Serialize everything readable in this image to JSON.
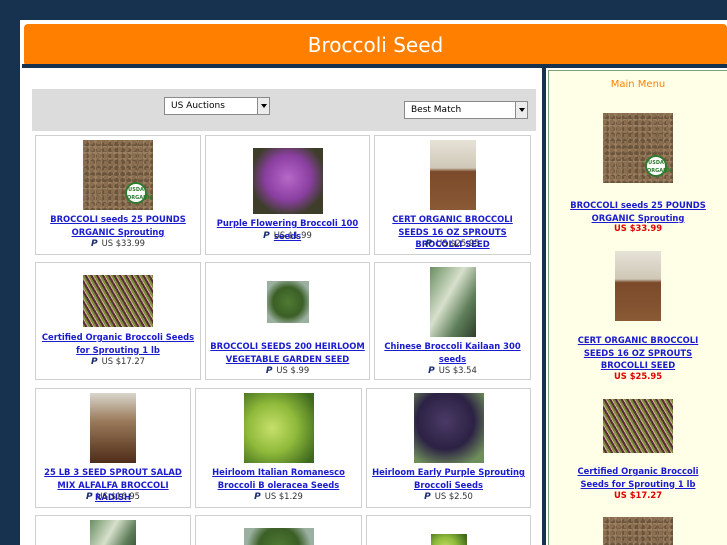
{
  "page": {
    "title": "Broccoli Seed"
  },
  "controls": {
    "auction_filter": "US Auctions",
    "sort_order": "Best Match"
  },
  "listings": [
    {
      "title": "BROCCOLI seeds 25 POUNDS ORGANIC Sprouting",
      "price": "US $33.99",
      "image": "seeds-organic"
    },
    {
      "title": "Purple Flowering Broccoli 100 seeds",
      "price": "US $1.99",
      "image": "purple-broccoli"
    },
    {
      "title": "CERT ORGANIC BROCCOLI SEEDS 16 OZ SPROUTS BROCOLLI SEED",
      "price": "US $25.95",
      "image": "seed-bag"
    },
    {
      "title": "Certified Organic Broccoli Seeds for Sprouting 1 lb",
      "price": "US $17.27",
      "image": "sprouts"
    },
    {
      "title": "BROCCOLI SEEDS 200 HEIRLOOM VEGETABLE GARDEN SEED",
      "price": "US $.99",
      "image": "broccoli-head"
    },
    {
      "title": "Chinese Broccoli Kailaan 300 seeds",
      "price": "US $3.54",
      "image": "kailaan"
    },
    {
      "title": "25 LB 3 SEED SPROUT SALAD MIX ALFALFA BROCCOLI RADISH",
      "price": "US $16.95",
      "image": "sprout-bag"
    },
    {
      "title": "Heirloom Italian Romanesco Broccoli B oleracea Seeds",
      "price": "US $1.29",
      "image": "romanesco"
    },
    {
      "title": "Heirloom Early Purple Sprouting Broccoli Seeds",
      "price": "US $2.50",
      "image": "purple-sprouting"
    }
  ],
  "sidebar": {
    "heading": "Main Menu",
    "items": [
      {
        "title": "BROCCOLI seeds 25 POUNDS ORGANIC Sprouting",
        "price": "US $33.99"
      },
      {
        "title": "CERT ORGANIC BROCCOLI SEEDS 16 OZ SPROUTS BROCOLLI SEED",
        "price": "US $25.95"
      },
      {
        "title": "Certified Organic Broccoli Seeds for Sprouting 1 lb",
        "price": "US $17.27"
      }
    ]
  },
  "badges": {
    "paypal": "P",
    "usda_top": "USDA",
    "usda_bottom": "ORGANIC"
  },
  "colors": {
    "header": "#ff8000",
    "background": "#16324f",
    "link": "#1b1bcf",
    "price_red": "#e00000",
    "sidebar_bg": "#ffffe8"
  }
}
